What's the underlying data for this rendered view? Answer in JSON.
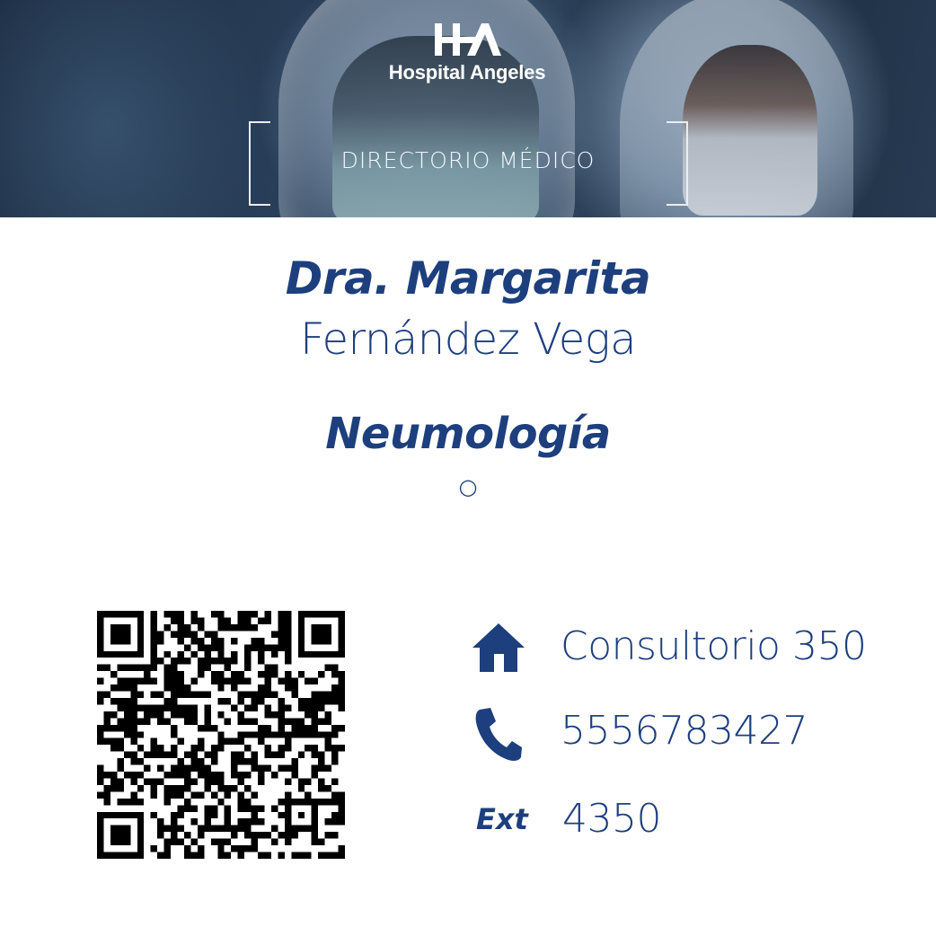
{
  "header": {
    "hospital_name": "Hospital Angeles",
    "directory_title": "DIRECTORIO MÉDICO"
  },
  "doctor": {
    "first_line": "Dra. Margarita",
    "last_name": "Fernández Vega",
    "specialty": "Neumología",
    "sub_specialty": "○"
  },
  "contact": {
    "office": "Consultorio 350",
    "phone": "5556783427",
    "ext_label": "Ext",
    "ext": "4350"
  },
  "icons": {
    "office": "home-icon",
    "phone": "phone-icon"
  },
  "colors": {
    "brand_blue": "#1d3f7e",
    "white": "#ffffff"
  }
}
